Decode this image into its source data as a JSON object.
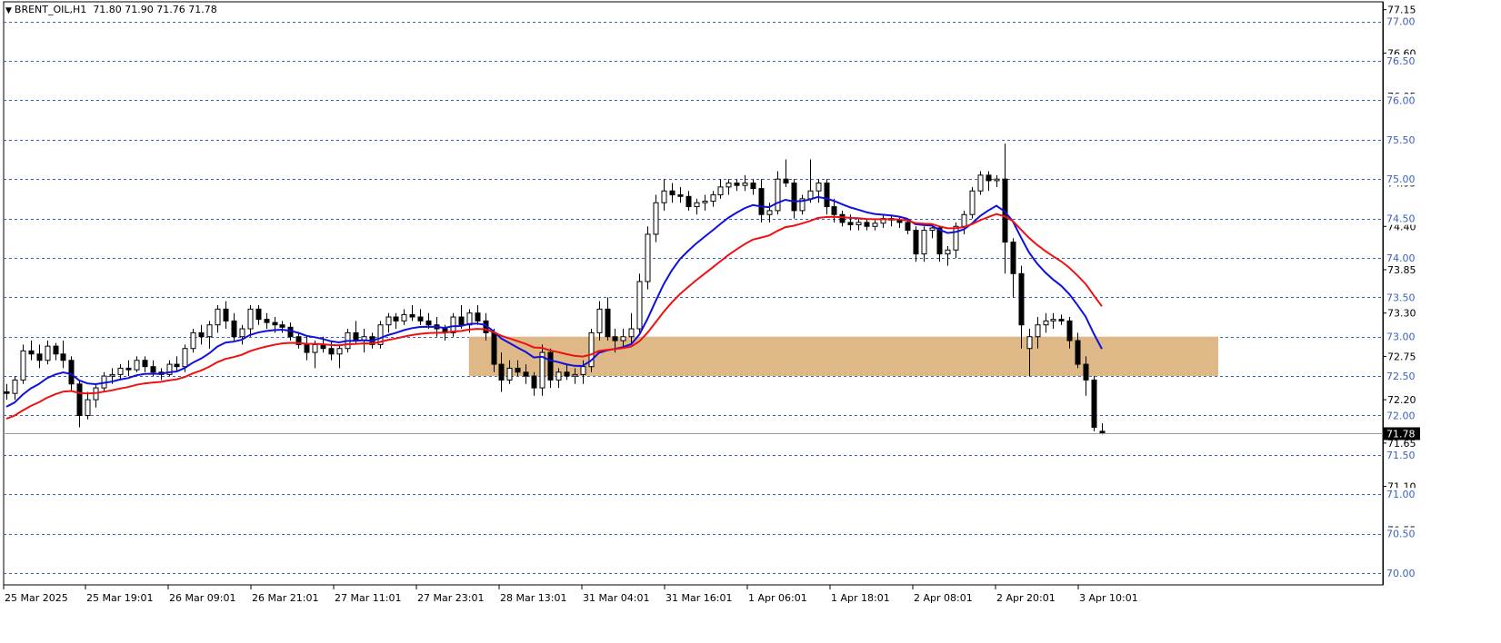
{
  "header": {
    "symbol": "BRENT_OIL,H1",
    "ohlc": "71.80 71.90 71.76 71.78"
  },
  "chart_data": {
    "type": "candlestick",
    "symbol": "BRENT_OIL",
    "timeframe": "H1",
    "ylim": [
      69.85,
      77.25
    ],
    "price_ticks": [
      "77.15",
      "76.60",
      "76.05",
      "75.50",
      "74.95",
      "74.40",
      "73.85",
      "73.30",
      "72.75",
      "72.20",
      "71.65",
      "71.10",
      "70.55",
      "70.00"
    ],
    "horizontal_levels": [
      "77.00",
      "76.50",
      "76.00",
      "75.50",
      "75.00",
      "74.50",
      "74.00",
      "73.50",
      "73.00",
      "72.50",
      "72.00",
      "71.50",
      "71.00",
      "70.50",
      "70.00"
    ],
    "current_price": "71.78",
    "time_labels": [
      "25 Mar 2025",
      "25 Mar 19:01",
      "26 Mar 09:01",
      "26 Mar 21:01",
      "27 Mar 11:01",
      "27 Mar 23:01",
      "28 Mar 13:01",
      "31 Mar 04:01",
      "31 Mar 16:01",
      "1 Apr 06:01",
      "1 Apr 18:01",
      "2 Apr 08:01",
      "2 Apr 20:01",
      "3 Apr 10:01"
    ],
    "zone": {
      "low": 72.5,
      "high": 73.0,
      "color": "#deb887"
    },
    "colors": {
      "ma_fast": "#1010dd",
      "ma_slow": "#ee1111",
      "level_line": "#3b5fc0",
      "current_line": "#9a9a9a"
    },
    "candles": [
      [
        72.3,
        72.4,
        72.2,
        72.28
      ],
      [
        72.28,
        72.5,
        72.2,
        72.45
      ],
      [
        72.45,
        72.9,
        72.4,
        72.82
      ],
      [
        72.82,
        72.95,
        72.7,
        72.78
      ],
      [
        72.78,
        72.9,
        72.6,
        72.7
      ],
      [
        72.7,
        72.95,
        72.65,
        72.88
      ],
      [
        72.88,
        72.92,
        72.7,
        72.78
      ],
      [
        72.78,
        72.95,
        72.6,
        72.7
      ],
      [
        72.7,
        72.75,
        72.3,
        72.4
      ],
      [
        72.4,
        72.45,
        71.85,
        72.0
      ],
      [
        72.0,
        72.3,
        71.95,
        72.2
      ],
      [
        72.2,
        72.4,
        72.1,
        72.35
      ],
      [
        72.35,
        72.55,
        72.3,
        72.5
      ],
      [
        72.5,
        72.6,
        72.4,
        72.52
      ],
      [
        72.52,
        72.65,
        72.45,
        72.6
      ],
      [
        72.6,
        72.7,
        72.5,
        72.58
      ],
      [
        72.58,
        72.75,
        72.55,
        72.7
      ],
      [
        72.7,
        72.75,
        72.55,
        72.62
      ],
      [
        72.62,
        72.7,
        72.5,
        72.55
      ],
      [
        72.55,
        72.6,
        72.45,
        72.52
      ],
      [
        72.52,
        72.7,
        72.5,
        72.65
      ],
      [
        72.65,
        72.75,
        72.55,
        72.62
      ],
      [
        72.62,
        72.9,
        72.55,
        72.85
      ],
      [
        72.85,
        73.1,
        72.8,
        73.05
      ],
      [
        73.05,
        73.15,
        72.9,
        73.0
      ],
      [
        73.0,
        73.2,
        72.85,
        73.15
      ],
      [
        73.15,
        73.4,
        73.05,
        73.35
      ],
      [
        73.35,
        73.45,
        73.1,
        73.2
      ],
      [
        73.2,
        73.3,
        72.95,
        73.0
      ],
      [
        73.0,
        73.15,
        72.9,
        73.1
      ],
      [
        73.1,
        73.4,
        73.0,
        73.35
      ],
      [
        73.35,
        73.4,
        73.15,
        73.22
      ],
      [
        73.22,
        73.3,
        73.1,
        73.18
      ],
      [
        73.18,
        73.25,
        73.05,
        73.15
      ],
      [
        73.15,
        73.2,
        73.05,
        73.12
      ],
      [
        73.12,
        73.18,
        72.95,
        73.0
      ],
      [
        73.0,
        73.05,
        72.85,
        72.9
      ],
      [
        72.9,
        73.0,
        72.7,
        72.8
      ],
      [
        72.8,
        72.95,
        72.6,
        72.9
      ],
      [
        72.9,
        73.0,
        72.8,
        72.85
      ],
      [
        72.85,
        72.95,
        72.7,
        72.78
      ],
      [
        72.78,
        72.9,
        72.6,
        72.85
      ],
      [
        72.85,
        73.1,
        72.8,
        73.05
      ],
      [
        73.05,
        73.2,
        72.9,
        72.95
      ],
      [
        72.95,
        73.1,
        72.8,
        73.0
      ],
      [
        73.0,
        73.05,
        72.85,
        72.9
      ],
      [
        72.9,
        73.2,
        72.85,
        73.15
      ],
      [
        73.15,
        73.3,
        73.05,
        73.25
      ],
      [
        73.25,
        73.3,
        73.1,
        73.2
      ],
      [
        73.2,
        73.35,
        73.15,
        73.28
      ],
      [
        73.28,
        73.4,
        73.2,
        73.25
      ],
      [
        73.25,
        73.35,
        73.15,
        73.2
      ],
      [
        73.2,
        73.3,
        73.1,
        73.15
      ],
      [
        73.15,
        73.25,
        73.0,
        73.1
      ],
      [
        73.1,
        73.15,
        72.95,
        73.05
      ],
      [
        73.05,
        73.3,
        73.0,
        73.25
      ],
      [
        73.25,
        73.4,
        73.1,
        73.15
      ],
      [
        73.15,
        73.35,
        73.05,
        73.3
      ],
      [
        73.3,
        73.4,
        73.15,
        73.2
      ],
      [
        73.2,
        73.3,
        72.95,
        73.05
      ],
      [
        73.05,
        73.1,
        72.55,
        72.65
      ],
      [
        72.65,
        72.8,
        72.3,
        72.45
      ],
      [
        72.45,
        72.7,
        72.4,
        72.6
      ],
      [
        72.6,
        72.7,
        72.5,
        72.55
      ],
      [
        72.55,
        72.65,
        72.4,
        72.5
      ],
      [
        72.5,
        72.55,
        72.25,
        72.35
      ],
      [
        72.35,
        72.9,
        72.25,
        72.8
      ],
      [
        72.8,
        72.85,
        72.35,
        72.45
      ],
      [
        72.45,
        72.6,
        72.35,
        72.55
      ],
      [
        72.55,
        72.65,
        72.45,
        72.5
      ],
      [
        72.5,
        72.6,
        72.4,
        72.52
      ],
      [
        72.52,
        72.7,
        72.4,
        72.62
      ],
      [
        72.62,
        73.1,
        72.55,
        73.05
      ],
      [
        73.05,
        73.45,
        72.95,
        73.35
      ],
      [
        73.35,
        73.5,
        72.95,
        73.0
      ],
      [
        73.0,
        73.1,
        72.8,
        72.95
      ],
      [
        72.95,
        73.1,
        72.85,
        73.0
      ],
      [
        73.0,
        73.3,
        72.9,
        73.1
      ],
      [
        73.1,
        73.8,
        73.05,
        73.7
      ],
      [
        73.7,
        74.4,
        73.6,
        74.3
      ],
      [
        74.3,
        74.8,
        74.2,
        74.7
      ],
      [
        74.7,
        75.0,
        74.6,
        74.85
      ],
      [
        74.85,
        74.95,
        74.7,
        74.8
      ],
      [
        74.8,
        74.9,
        74.7,
        74.78
      ],
      [
        74.78,
        74.85,
        74.6,
        74.65
      ],
      [
        74.65,
        74.75,
        74.55,
        74.7
      ],
      [
        74.7,
        74.8,
        74.6,
        74.72
      ],
      [
        74.72,
        74.85,
        74.65,
        74.8
      ],
      [
        74.8,
        75.0,
        74.75,
        74.9
      ],
      [
        74.9,
        75.0,
        74.8,
        74.95
      ],
      [
        74.95,
        75.0,
        74.85,
        74.92
      ],
      [
        74.92,
        75.05,
        74.85,
        74.95
      ],
      [
        74.95,
        75.0,
        74.8,
        74.88
      ],
      [
        74.88,
        75.0,
        74.45,
        74.55
      ],
      [
        74.55,
        74.7,
        74.45,
        74.6
      ],
      [
        74.6,
        75.1,
        74.55,
        75.0
      ],
      [
        75.0,
        75.25,
        74.9,
        74.95
      ],
      [
        74.95,
        75.0,
        74.5,
        74.6
      ],
      [
        74.6,
        74.8,
        74.55,
        74.75
      ],
      [
        74.75,
        75.25,
        74.7,
        74.85
      ],
      [
        74.85,
        75.0,
        74.7,
        74.95
      ],
      [
        74.95,
        75.0,
        74.55,
        74.65
      ],
      [
        74.65,
        74.75,
        74.45,
        74.55
      ],
      [
        74.55,
        74.6,
        74.4,
        74.45
      ],
      [
        74.45,
        74.55,
        74.35,
        74.42
      ],
      [
        74.42,
        74.5,
        74.35,
        74.45
      ],
      [
        74.45,
        74.5,
        74.35,
        74.4
      ],
      [
        74.4,
        74.48,
        74.35,
        74.44
      ],
      [
        74.44,
        74.55,
        74.38,
        74.5
      ],
      [
        74.5,
        74.55,
        74.4,
        74.48
      ],
      [
        74.48,
        74.52,
        74.38,
        74.45
      ],
      [
        74.45,
        74.5,
        74.3,
        74.35
      ],
      [
        74.35,
        74.4,
        73.95,
        74.05
      ],
      [
        74.05,
        74.4,
        73.95,
        74.35
      ],
      [
        74.35,
        74.42,
        74.25,
        74.38
      ],
      [
        74.38,
        74.4,
        73.95,
        74.05
      ],
      [
        74.05,
        74.15,
        73.9,
        74.1
      ],
      [
        74.1,
        74.45,
        74.0,
        74.4
      ],
      [
        74.4,
        74.6,
        74.3,
        74.55
      ],
      [
        74.55,
        74.9,
        74.5,
        74.85
      ],
      [
        74.85,
        75.1,
        74.8,
        75.05
      ],
      [
        75.05,
        75.1,
        74.85,
        74.98
      ],
      [
        74.98,
        75.05,
        74.9,
        75.0
      ],
      [
        75.0,
        75.45,
        73.8,
        74.2
      ],
      [
        74.2,
        74.25,
        73.5,
        73.8
      ],
      [
        73.8,
        73.9,
        72.85,
        73.15
      ],
      [
        72.85,
        73.1,
        72.5,
        73.0
      ],
      [
        73.0,
        73.25,
        72.85,
        73.15
      ],
      [
        73.15,
        73.3,
        73.05,
        73.2
      ],
      [
        73.2,
        73.3,
        73.1,
        73.22
      ],
      [
        73.22,
        73.28,
        73.15,
        73.2
      ],
      [
        73.2,
        73.25,
        72.85,
        72.95
      ],
      [
        72.95,
        73.05,
        72.6,
        72.65
      ],
      [
        72.65,
        72.75,
        72.25,
        72.45
      ],
      [
        72.45,
        72.5,
        71.8,
        71.85
      ],
      [
        71.8,
        71.9,
        71.76,
        71.78
      ]
    ]
  }
}
